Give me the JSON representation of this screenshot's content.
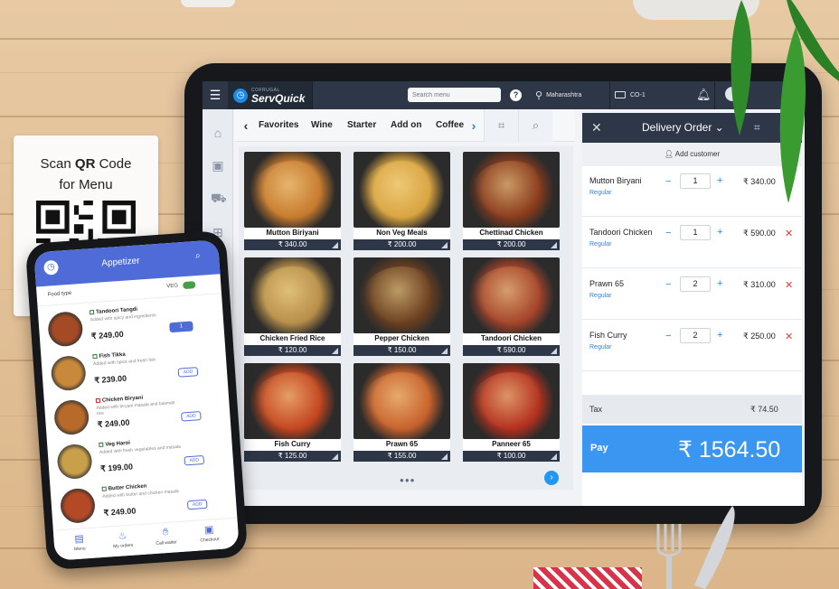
{
  "qr_card": {
    "line1_prefix": "Scan ",
    "line1_bold": "QR",
    "line1_suffix": " Code",
    "line2": "for Menu"
  },
  "tablet": {
    "brand_small": "COFRUGAL",
    "brand_name": "ServQuick",
    "search_placeholder": "Search menu",
    "location": "Maharashtra",
    "counter": "CO-1",
    "categories": [
      "Favorites",
      "Wine",
      "Starter",
      "Add on",
      "Coffee"
    ],
    "items": [
      {
        "name": "Mutton Biriyani",
        "price": "₹ 340.00",
        "color": "#c77a2e"
      },
      {
        "name": "Non Veg Meals",
        "price": "₹ 200.00",
        "color": "#d9a441"
      },
      {
        "name": "Chettinad Chicken",
        "price": "₹ 200.00",
        "color": "#8a3b1c"
      },
      {
        "name": "Chicken Fried Rice",
        "price": "₹ 120.00",
        "color": "#b88f4a"
      },
      {
        "name": "Pepper Chicken",
        "price": "₹ 150.00",
        "color": "#6b3f1f"
      },
      {
        "name": "Tandoori Chicken",
        "price": "₹ 590.00",
        "color": "#a6442a"
      },
      {
        "name": "Fish Curry",
        "price": "₹ 125.00",
        "color": "#c4451f"
      },
      {
        "name": "Prawn 65",
        "price": "₹ 155.00",
        "color": "#c8612c"
      },
      {
        "name": "Panneer 65",
        "price": "₹ 100.00",
        "color": "#b3301e"
      }
    ],
    "pager_dots": "●●●",
    "order": {
      "title": "Delivery Order ⌄",
      "add_customer": "Add customer",
      "lines": [
        {
          "name": "Mutton Biryani",
          "variant": "Regular",
          "qty": "1",
          "amount": "₹ 340.00"
        },
        {
          "name": "Tandoori Chicken",
          "variant": "Regular",
          "qty": "1",
          "amount": "₹ 590.00"
        },
        {
          "name": "Prawn 65",
          "variant": "Regular",
          "qty": "2",
          "amount": "₹ 310.00"
        },
        {
          "name": "Fish Curry",
          "variant": "Regular",
          "qty": "2",
          "amount": "₹ 250.00"
        }
      ],
      "tax_label": "Tax",
      "tax_value": "₹ 74.50",
      "pay_label": "Pay",
      "pay_value": "₹ 1564.50"
    }
  },
  "phone": {
    "title": "Appetizer",
    "food_type": "Food type",
    "veg_label": "VEG",
    "items": [
      {
        "name": "Tandoori Tangdi",
        "desc": "Added with spicy and ingredients",
        "price": "₹ 249.00",
        "action": "1",
        "veg": true
      },
      {
        "name": "Fish Tikka",
        "desc": "Added with spice and fresh fish",
        "price": "₹ 239.00",
        "action": "ADD",
        "veg": true
      },
      {
        "name": "Chicken Biryani",
        "desc": "Added with biryani masala and basmati rice",
        "price": "₹ 249.00",
        "action": "ADD",
        "veg": false
      },
      {
        "name": "Veg Haroi",
        "desc": "Added with fresh vegetables and masala",
        "price": "₹ 199.00",
        "action": "ADD",
        "veg": true
      },
      {
        "name": "Butter Chicken",
        "desc": "Added with butter and chicken masala",
        "price": "₹ 249.00",
        "action": "ADD",
        "veg": true
      }
    ],
    "nav": [
      "Menu",
      "My orders",
      "Call waiter",
      "Checkout"
    ]
  }
}
